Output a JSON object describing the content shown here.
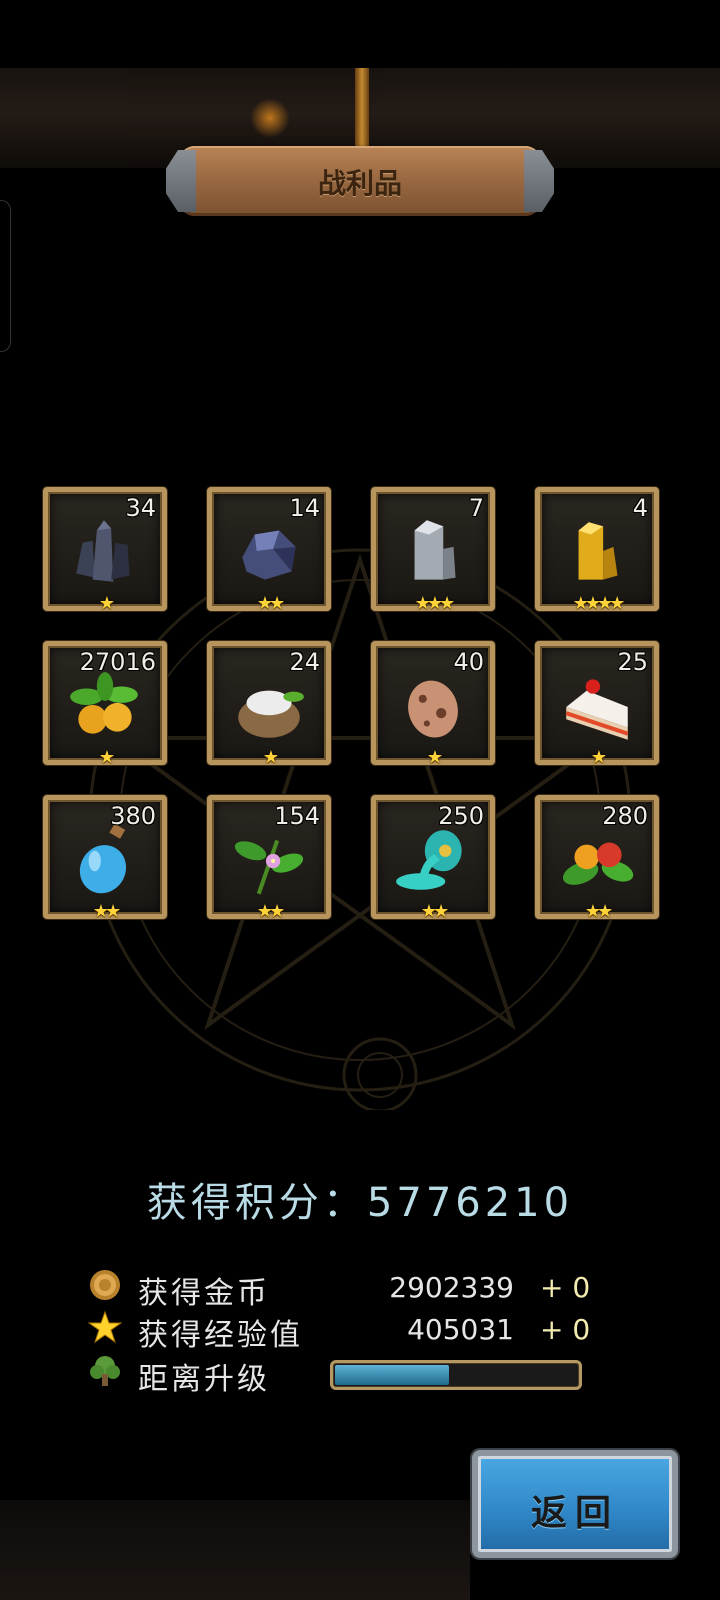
{
  "title": "战利品",
  "rewards": [
    {
      "count": "34",
      "stars": "★",
      "icon": "dark-crystal-icon"
    },
    {
      "count": "14",
      "stars": "★★",
      "icon": "dark-ore-icon"
    },
    {
      "count": "7",
      "stars": "★★★",
      "icon": "silver-crystal-icon"
    },
    {
      "count": "4",
      "stars": "★★★★",
      "icon": "gold-crystal-icon"
    },
    {
      "count": "27016",
      "stars": "★",
      "icon": "golden-fruit-plant-icon"
    },
    {
      "count": "24",
      "stars": "★",
      "icon": "flour-sack-icon"
    },
    {
      "count": "40",
      "stars": "★",
      "icon": "spotted-egg-icon"
    },
    {
      "count": "25",
      "stars": "★",
      "icon": "cake-slice-icon"
    },
    {
      "count": "380",
      "stars": "★★",
      "icon": "potion-bottle-icon"
    },
    {
      "count": "154",
      "stars": "★★",
      "icon": "herb-flower-icon"
    },
    {
      "count": "250",
      "stars": "★★",
      "icon": "slime-jar-icon"
    },
    {
      "count": "280",
      "stars": "★★",
      "icon": "berry-leaf-icon"
    }
  ],
  "score": {
    "label": "获得积分：",
    "value": "5776210"
  },
  "gold": {
    "label": "获得金币",
    "value": "2902339",
    "bonus": "+ 0",
    "icon": "gold-coin-icon"
  },
  "exp": {
    "label": "获得经验值",
    "value": "405031",
    "bonus": "+ 0",
    "icon": "star-icon"
  },
  "level": {
    "label": "距离升级",
    "progress": 0.48,
    "icon": "tree-icon"
  },
  "back_button": {
    "label": "返回"
  },
  "colors": {
    "frame": "#b8955c",
    "score_text": "#b9dbe6",
    "button_blue": "#2f86c6",
    "star": "#ffd33a"
  }
}
